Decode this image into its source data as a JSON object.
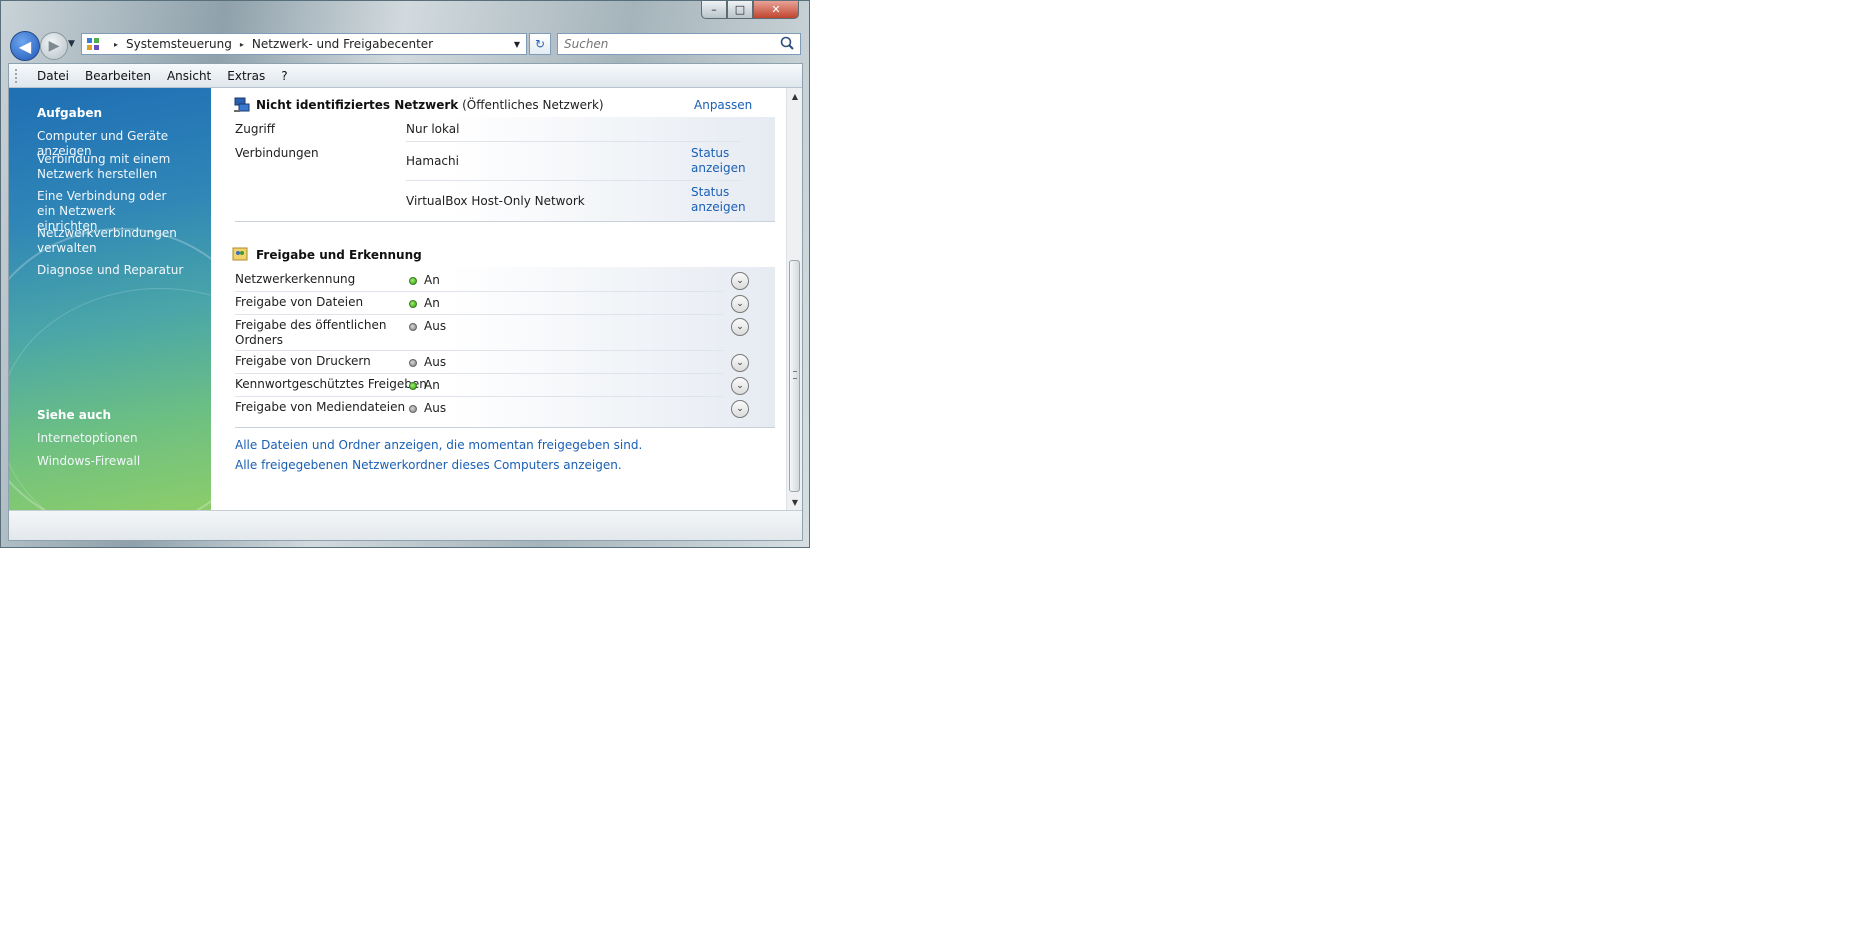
{
  "window": {
    "caption": {
      "minimize": "–",
      "maximize": "□",
      "close": "✕"
    }
  },
  "nav": {
    "back": "◀",
    "forward": "▶",
    "dropdown": "▼"
  },
  "address": {
    "crumbs": [
      "Systemsteuerung",
      "Netzwerk- und Freigabecenter"
    ],
    "separator": "▸",
    "dropdown": "▼",
    "refresh": "↻"
  },
  "search": {
    "placeholder": "Suchen"
  },
  "menu": {
    "items": [
      "Datei",
      "Bearbeiten",
      "Ansicht",
      "Extras",
      "?"
    ]
  },
  "sidebar": {
    "tasks_heading": "Aufgaben",
    "tasks": [
      "Computer und Geräte anzeigen",
      "Verbindung mit einem Netzwerk herstellen",
      "Eine Verbindung oder ein Netzwerk einrichten",
      "Netzwerkverbindungen verwalten",
      "Diagnose und Reparatur"
    ],
    "see_also_heading": "Siehe auch",
    "see_also": [
      "Internetoptionen",
      "Windows-Firewall"
    ]
  },
  "network": {
    "name": "Nicht identifiziertes Netzwerk",
    "type": "(Öffentliches Netzwerk)",
    "customize": "Anpassen",
    "access_label": "Zugriff",
    "access_value": "Nur lokal",
    "connections_label": "Verbindungen",
    "connections": [
      {
        "name": "Hamachi",
        "action": "Status anzeigen"
      },
      {
        "name": "VirtualBox Host-Only Network",
        "action": "Status anzeigen"
      }
    ]
  },
  "sharing": {
    "title": "Freigabe und Erkennung",
    "rows": [
      {
        "label": "Netzwerkerkennung",
        "status": "An",
        "on": true
      },
      {
        "label": "Freigabe von Dateien",
        "status": "An",
        "on": true
      },
      {
        "label": "Freigabe des öffentlichen Ordners",
        "status": "Aus",
        "on": false
      },
      {
        "label": "Freigabe von Druckern",
        "status": "Aus",
        "on": false
      },
      {
        "label": "Kennwortgeschütztes Freigeben",
        "status": "An",
        "on": true
      },
      {
        "label": "Freigabe von Mediendateien",
        "status": "Aus",
        "on": false
      }
    ],
    "expand_glyph": "⌄"
  },
  "footer_links": [
    "Alle Dateien und Ordner anzeigen, die momentan freigegeben sind.",
    "Alle freigegebenen Netzwerkordner dieses Computers anzeigen."
  ],
  "scrollbar": {
    "up": "▲",
    "down": "▼"
  }
}
